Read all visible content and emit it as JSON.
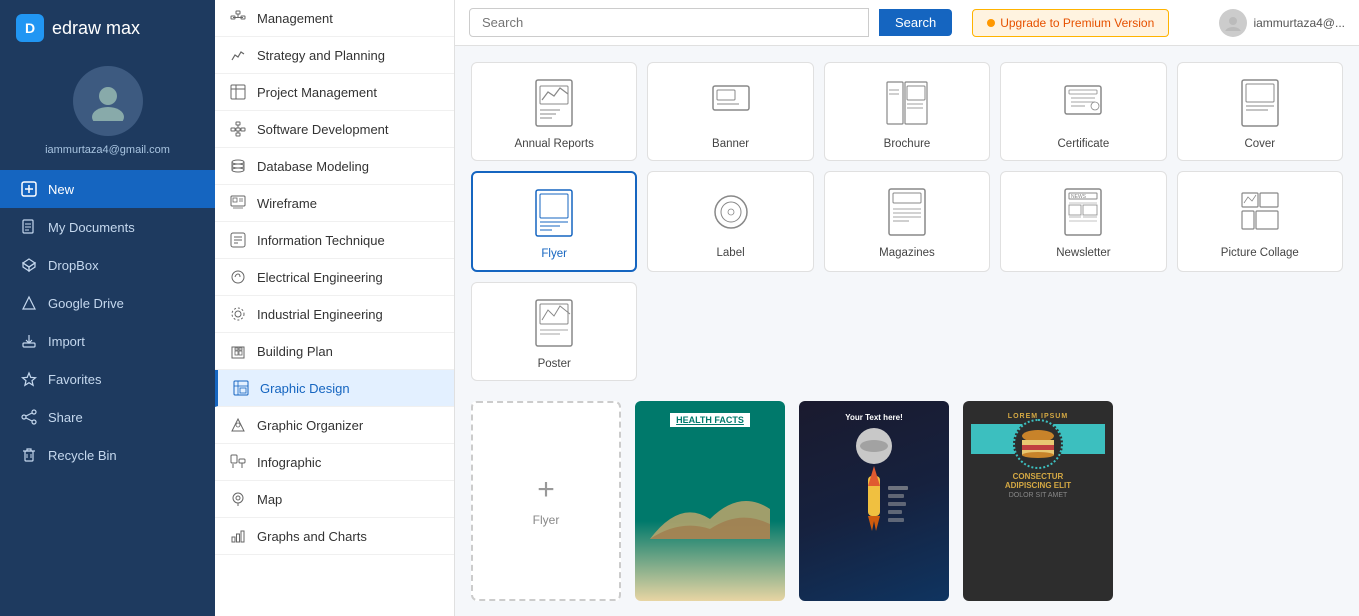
{
  "logo": {
    "text": "edraw max"
  },
  "user": {
    "email": "iammurtaza4@gmail.com",
    "email_short": "iammurtaza4@..."
  },
  "sidebar": {
    "items": [
      {
        "id": "new",
        "label": "New",
        "icon": "plus"
      },
      {
        "id": "my-documents",
        "label": "My Documents",
        "icon": "file"
      },
      {
        "id": "dropbox",
        "label": "DropBox",
        "icon": "grid"
      },
      {
        "id": "google-drive",
        "label": "Google Drive",
        "icon": "triangle"
      },
      {
        "id": "import",
        "label": "Import",
        "icon": "sign-in"
      },
      {
        "id": "favorites",
        "label": "Favorites",
        "icon": "star"
      },
      {
        "id": "share",
        "label": "Share",
        "icon": "share"
      },
      {
        "id": "recycle-bin",
        "label": "Recycle Bin",
        "icon": "trash"
      }
    ]
  },
  "middle_panel": {
    "items": [
      {
        "id": "management",
        "label": "Management",
        "icon": "org"
      },
      {
        "id": "strategy",
        "label": "Strategy and Planning",
        "icon": "chart-line"
      },
      {
        "id": "project-mgmt",
        "label": "Project Management",
        "icon": "table"
      },
      {
        "id": "software-dev",
        "label": "Software Development",
        "icon": "hierarchy"
      },
      {
        "id": "database",
        "label": "Database Modeling",
        "icon": "database"
      },
      {
        "id": "wireframe",
        "label": "Wireframe",
        "icon": "wireframe"
      },
      {
        "id": "info-tech",
        "label": "Information Technique",
        "icon": "info"
      },
      {
        "id": "electrical",
        "label": "Electrical Engineering",
        "icon": "circuit"
      },
      {
        "id": "industrial",
        "label": "Industrial Engineering",
        "icon": "gear"
      },
      {
        "id": "building",
        "label": "Building Plan",
        "icon": "building"
      },
      {
        "id": "graphic-design",
        "label": "Graphic Design",
        "icon": "palette",
        "active": true
      },
      {
        "id": "graphic-organizer",
        "label": "Graphic Organizer",
        "icon": "organizer"
      },
      {
        "id": "infographic",
        "label": "Infographic",
        "icon": "infographic"
      },
      {
        "id": "map",
        "label": "Map",
        "icon": "map"
      },
      {
        "id": "graphs-charts",
        "label": "Graphs and Charts",
        "icon": "bar-chart"
      }
    ]
  },
  "topbar": {
    "search_placeholder": "Search",
    "search_button": "Search",
    "upgrade_button": "Upgrade to Premium Version",
    "user_email": "iammurtaza4@..."
  },
  "template_cards": [
    {
      "id": "annual-reports",
      "label": "Annual Reports",
      "selected": false
    },
    {
      "id": "banner",
      "label": "Banner",
      "selected": false
    },
    {
      "id": "brochure",
      "label": "Brochure",
      "selected": false
    },
    {
      "id": "certificate",
      "label": "Certificate",
      "selected": false
    },
    {
      "id": "cover",
      "label": "Cover",
      "selected": false
    },
    {
      "id": "flyer",
      "label": "Flyer",
      "selected": true
    },
    {
      "id": "label",
      "label": "Label",
      "selected": false
    },
    {
      "id": "magazines",
      "label": "Magazines",
      "selected": false
    },
    {
      "id": "newsletter",
      "label": "Newsletter",
      "selected": false
    },
    {
      "id": "picture-collage",
      "label": "Picture Collage",
      "selected": false
    },
    {
      "id": "poster",
      "label": "Poster",
      "selected": false
    }
  ],
  "flyer_section": {
    "new_label": "Flyer",
    "previews": [
      {
        "id": "space-preview",
        "type": "space",
        "text": "Your Text here!"
      },
      {
        "id": "burger-preview",
        "type": "burger",
        "lines": [
          "LOREM IPSUM",
          "CONSECTUR",
          "ADIPISCING ELIT",
          "DOLOR SIT AMET"
        ]
      }
    ]
  },
  "health_preview": {
    "title": "HEALTH FACTS"
  }
}
